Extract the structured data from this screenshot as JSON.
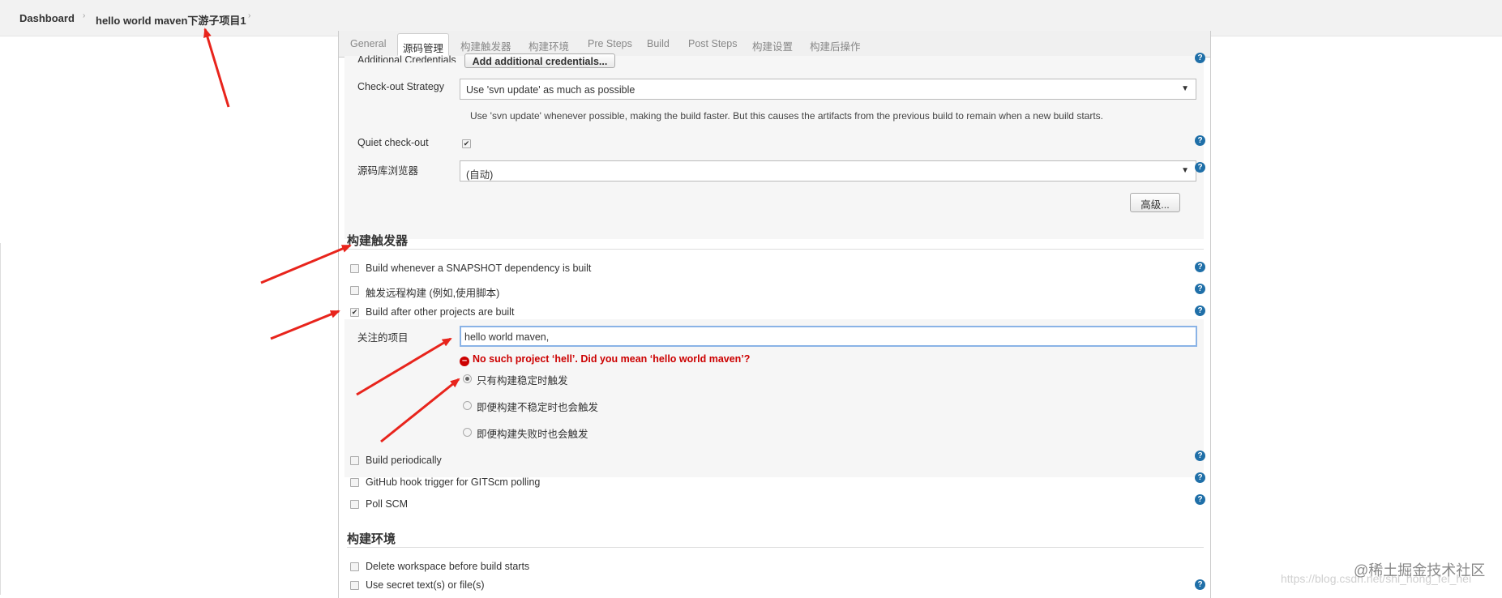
{
  "breadcrumb": {
    "home": "Dashboard",
    "project": "hello world maven下游子项目1",
    "sep": "›"
  },
  "tabs": [
    {
      "label": "General"
    },
    {
      "label": "源码管理"
    },
    {
      "label": "构建触发器"
    },
    {
      "label": "构建环境"
    },
    {
      "label": "Pre Steps"
    },
    {
      "label": "Build"
    },
    {
      "label": "Post Steps"
    },
    {
      "label": "构建设置"
    },
    {
      "label": "构建后操作"
    }
  ],
  "scm": {
    "credentials_label": "Additional Credentials",
    "credentials_button": "Add additional credentials...",
    "checkout_label": "Check-out Strategy",
    "checkout_value": "Use 'svn update' as much as possible",
    "checkout_desc": "Use 'svn update' whenever possible, making the build faster. But this causes the artifacts from the previous build to remain when a new build starts.",
    "quiet_label": "Quiet check-out",
    "browser_label": "源码库浏览器",
    "browser_value": "(自动)",
    "advanced_button": "高级..."
  },
  "triggers": {
    "heading": "构建触发器",
    "snapshot": "Build whenever a SNAPSHOT dependency is built",
    "remote": "触发远程构建 (例如,使用脚本)",
    "after_other": "Build after other projects are built",
    "watched_label": "关注的项目",
    "watched_value": "hello world maven,",
    "error": "No such project ‘hell’. Did you mean ‘hello world maven’?",
    "radio_stable": "只有构建稳定时触发",
    "radio_unstable": "即便构建不稳定时也会触发",
    "radio_failed": "即便构建失败时也会触发",
    "periodically": "Build periodically",
    "github": "GitHub hook trigger for GITScm polling",
    "poll": "Poll SCM"
  },
  "env": {
    "heading": "构建环境",
    "delete_ws": "Delete workspace before build starts",
    "secret": "Use secret text(s) or file(s)"
  },
  "watermark": {
    "brand": "@稀土掘金技术社区",
    "url": "https://blog.csdn.net/shi_hong_fei_hei"
  },
  "icons": {
    "help": "?",
    "check": "✔",
    "dropdown": "▼",
    "error": "–"
  },
  "colors": {
    "help": "#1f6fa8",
    "error": "#cc0000",
    "arrow": "#e8241c"
  }
}
